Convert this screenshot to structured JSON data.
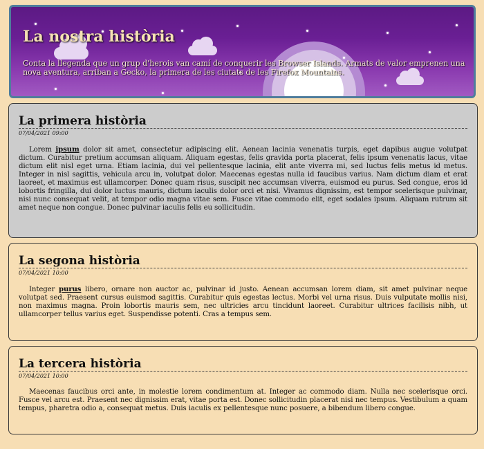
{
  "header": {
    "title": "La nostra història",
    "description": "Conta la llegenda que un grup d'herois van camí de conquerir les Browser Islands. Armats de valor emprenen una nova aventura, arriban a Gecko, la primera de les ciutats de les Firefox Mountains."
  },
  "articles": [
    {
      "title": "La primera història",
      "date": "07/04/2021 09:00",
      "body_before": "Lorem ",
      "keyword": "ipsum",
      "body_after": " dolor sit amet, consectetur adipiscing elit. Aenean lacinia venenatis turpis, eget dapibus augue volutpat dictum. Curabitur pretium accumsan aliquam. Aliquam egestas, felis gravida porta placerat, felis ipsum venenatis lacus, vitae dictum elit nisl eget urna. Etiam lacinia, dui vel pellentesque lacinia, elit ante viverra mi, sed luctus felis metus id metus. Integer in nisl sagittis, vehicula arcu in, volutpat dolor. Maecenas egestas nulla id faucibus varius. Nam dictum diam et erat laoreet, et maximus est ullamcorper. Donec quam risus, suscipit nec accumsan viverra, euismod eu purus. Sed congue, eros id lobortis fringilla, dui dolor luctus mauris, dictum iaculis dolor orci et nisi. Vivamus dignissim, est tempor scelerisque pulvinar, nisi nunc consequat velit, at tempor odio magna vitae sem. Fusce vitae commodo elit, eget sodales ipsum. Aliquam rutrum sit amet neque non congue. Donec pulvinar iaculis felis eu sollicitudin."
    },
    {
      "title": "La segona història",
      "date": "07/04/2021 10:00",
      "body_before": "Integer ",
      "keyword": "purus",
      "body_after": " libero, ornare non auctor ac, pulvinar id justo. Aenean accumsan lorem diam, sit amet pulvinar neque volutpat sed. Praesent cursus euismod sagittis. Curabitur quis egestas lectus. Morbi vel urna risus. Duis vulputate mollis nisi, non maximus magna. Proin lobortis mauris sem, nec ultricies arcu tincidunt laoreet. Curabitur ultrices facilisis nibh, ut ullamcorper tellus varius eget. Suspendisse potenti. Cras a tempus sem."
    },
    {
      "title": "La tercera història",
      "date": "07/04/2021 10:00",
      "body_before": "Maecenas faucibus orci ante, in molestie lorem condimentum at. Integer ac commodo diam. Nulla nec scelerisque orci. Fusce vel arcu est. Praesent nec dignissim erat, vitae porta est. Donec sollicitudin placerat nisi nec tempus. Vestibulum a quam tempus, pharetra odio a, consequat metus. Duis iaculis ex pellentesque nunc posuere, a bibendum libero congue.",
      "keyword": "",
      "body_after": ""
    }
  ],
  "colors": {
    "page_background": "#f7deb4",
    "first_article_background": "#cccccc",
    "header_gradient_top": "#5c1a84",
    "header_border": "#4f7d9c"
  }
}
